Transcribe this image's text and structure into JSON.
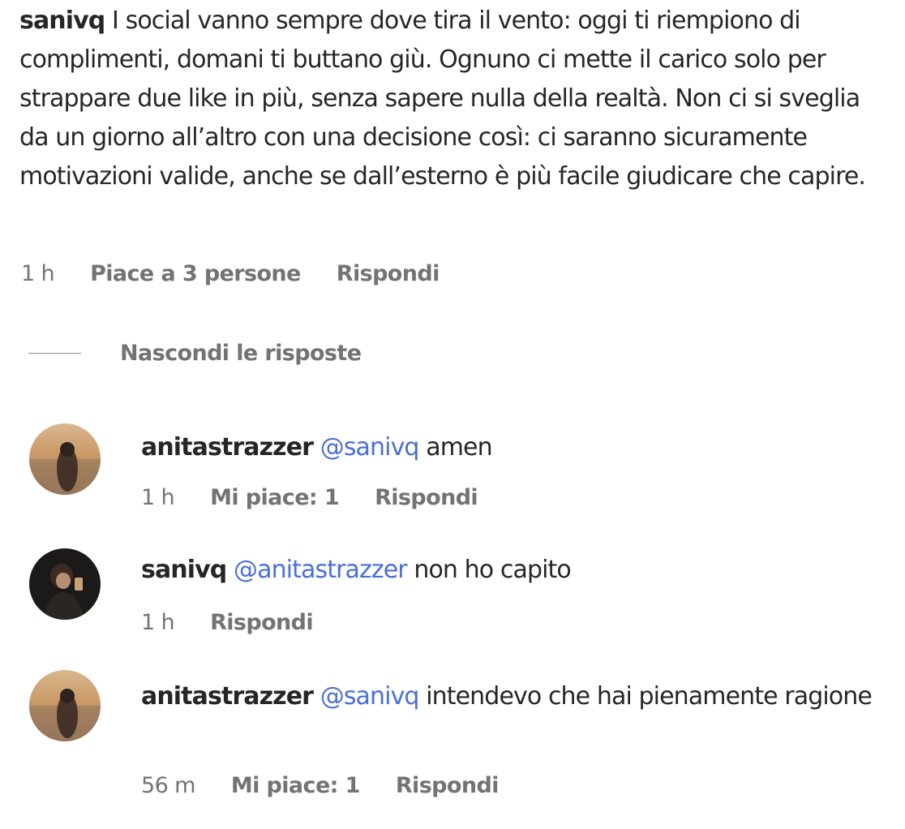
{
  "main_comment": {
    "username": "sanivq",
    "text": "I social vanno sempre dove tira il vento: oggi ti riempiono di complimenti, domani ti buttano giù. Ognuno ci mette il carico solo per strappare due like in più, senza sapere nulla della realtà. Non ci si sveglia da un giorno all’altro con una decisione così: ci saranno sicuramente motivazioni valide, anche se dall’esterno è più facile giudicare che capire.",
    "time": "1 h",
    "likes": "Piace a 3 persone",
    "reply_label": "Rispondi"
  },
  "replies_toggle": {
    "label": "Nascondi le risposte"
  },
  "replies": [
    {
      "username": "anitastrazzer",
      "mention": "@sanivq",
      "text": "amen",
      "time": "1 h",
      "likes": "Mi piace: 1",
      "reply_label": "Rispondi",
      "avatar_icon": "sunset-profile-avatar"
    },
    {
      "username": "sanivq",
      "mention": "@anitastrazzer",
      "text": "non ho capito",
      "time": "1 h",
      "reply_label": "Rispondi",
      "avatar_icon": "dark-profile-avatar"
    },
    {
      "username": "anitastrazzer",
      "mention": "@sanivq",
      "text": "intendevo che hai pienamente ragione",
      "time": "56 m",
      "likes": "Mi piace: 1",
      "reply_label": "Rispondi",
      "avatar_icon": "sunset-profile-avatar"
    }
  ],
  "colors": {
    "text": "#262626",
    "secondary": "#737373",
    "mention": "#4a6fd8"
  }
}
